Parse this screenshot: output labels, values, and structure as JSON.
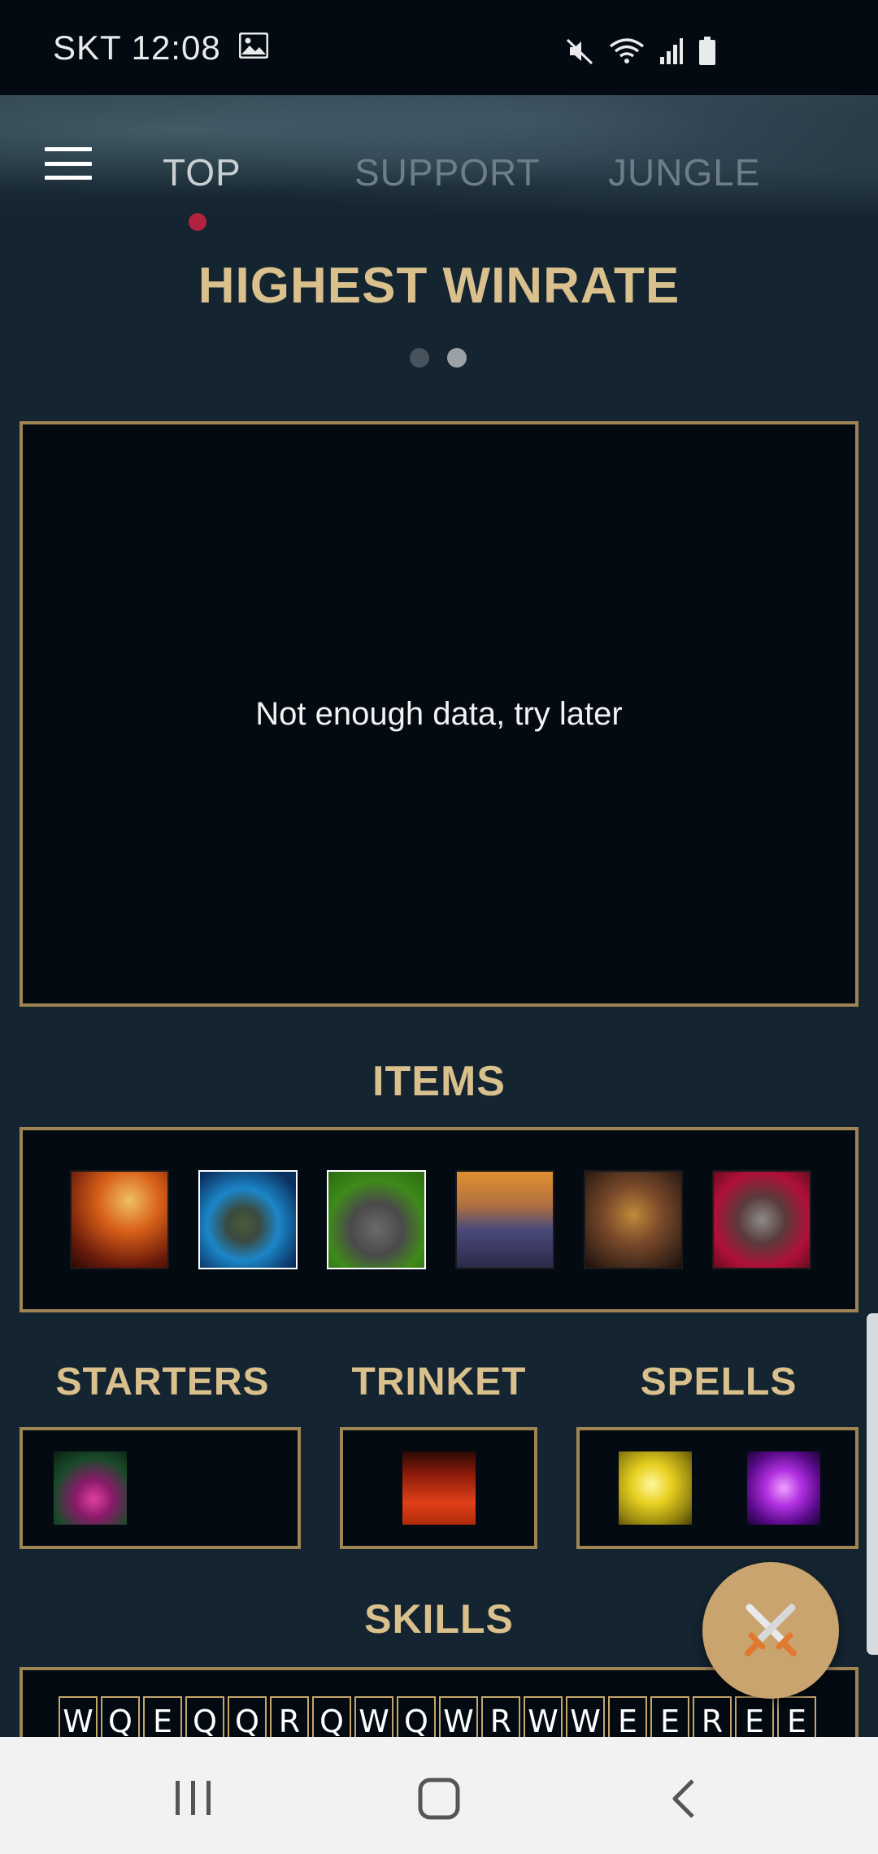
{
  "status_bar": {
    "carrier_time": "SKT 12:08",
    "icons": [
      "gallery-icon",
      "mute-icon",
      "wifi-icon",
      "signal-icon",
      "battery-icon"
    ]
  },
  "tabs": [
    {
      "label": "TOP",
      "active": true
    },
    {
      "label": "SUPPORT",
      "active": false
    },
    {
      "label": "JUNGLE",
      "active": false
    }
  ],
  "build": {
    "title": "HIGHEST WINRATE",
    "pager_dots": 2,
    "active_dot": 2,
    "message": "Not enough data, try later"
  },
  "items": {
    "title": "ITEMS",
    "icons": [
      "sunfire-cape-icon",
      "mercury-treads-icon",
      "warmogs-armor-icon",
      "spirit-visage-icon",
      "deadmans-plate-icon",
      "gargoyle-stoneplate-icon"
    ]
  },
  "starters": {
    "title": "STARTERS",
    "icons": [
      "corrupting-potion-icon"
    ]
  },
  "trinket": {
    "title": "TRINKET",
    "icons": [
      "oracle-lens-icon"
    ]
  },
  "spells": {
    "title": "SPELLS",
    "icons": [
      "flash-icon",
      "teleport-icon"
    ]
  },
  "skills": {
    "title": "SKILLS",
    "order": [
      "W",
      "Q",
      "E",
      "Q",
      "Q",
      "R",
      "Q",
      "W",
      "Q",
      "W",
      "R",
      "W",
      "W",
      "E",
      "E",
      "R",
      "E",
      "E"
    ]
  },
  "colors": {
    "background": "#142430",
    "gold_title": "#d9c08c",
    "box_border": "#a08554",
    "box_fill": "#030a12",
    "tab_indicator": "#b0223e",
    "fab": "#c9a46e"
  },
  "fab": {
    "icon": "crossed-swords-icon"
  }
}
